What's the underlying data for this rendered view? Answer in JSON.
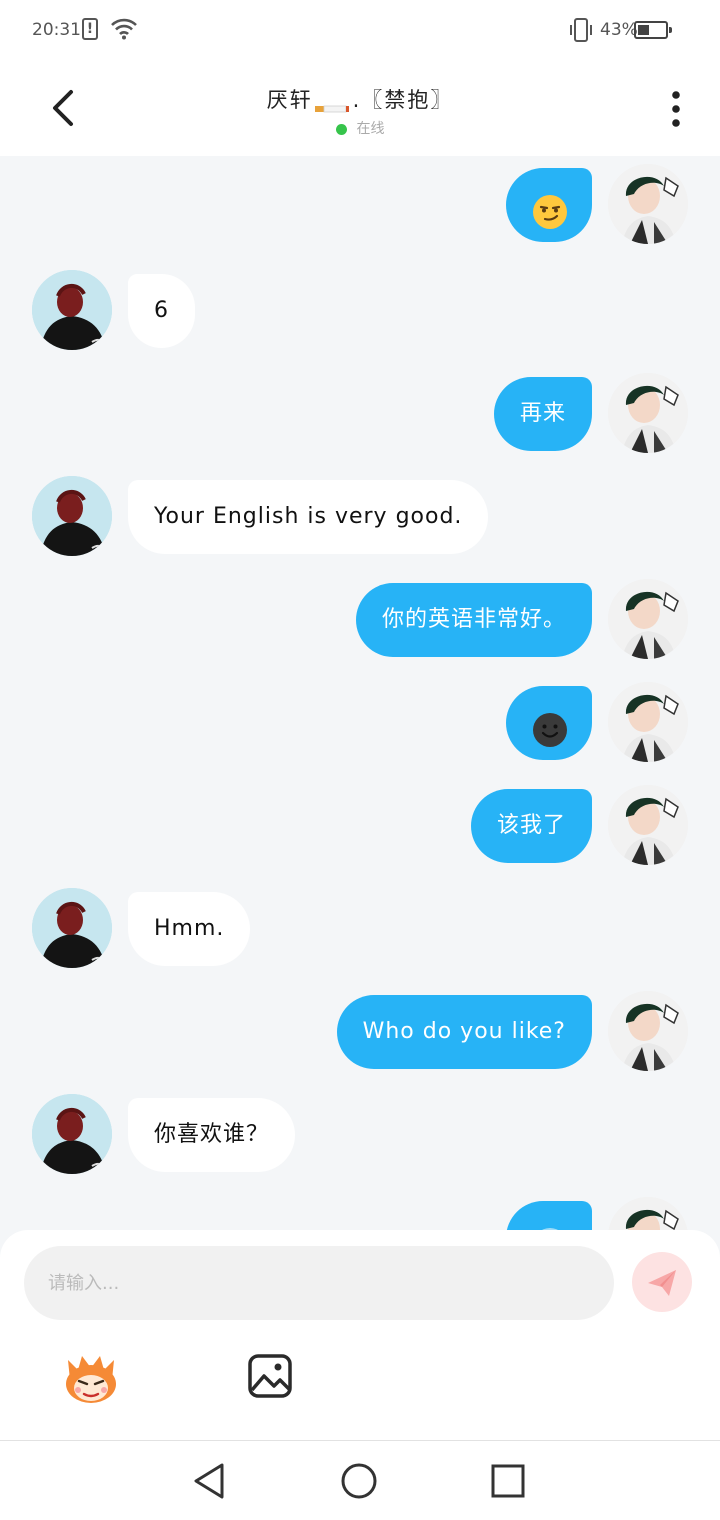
{
  "status_bar": {
    "time": "20:31",
    "sim_alert": "!",
    "battery_percent": "43%",
    "battery_level": 0.43
  },
  "header": {
    "title_pre": "厌轩",
    "title_post": ".〖禁抱〗",
    "status": "在线"
  },
  "messages": [
    {
      "side": "right",
      "emoji": "smirking-face"
    },
    {
      "side": "left",
      "text": "6"
    },
    {
      "side": "right",
      "text": "再来"
    },
    {
      "side": "left",
      "text": "Your English is very good."
    },
    {
      "side": "right",
      "text": "你的英语非常好。"
    },
    {
      "side": "right",
      "emoji": "dark-smiling-face"
    },
    {
      "side": "right",
      "text": "该我了"
    },
    {
      "side": "left",
      "text": "Hmm."
    },
    {
      "side": "right",
      "text": "Who do you like?"
    },
    {
      "side": "left",
      "text": "你喜欢谁？"
    },
    {
      "side": "right",
      "emoji": "partially-visible-emoji"
    }
  ],
  "composer": {
    "placeholder": "请输入..."
  },
  "colors": {
    "accent": "#27b3f6",
    "online": "#36c44b",
    "background": "#f4f6f8",
    "send_button": "#fde2e2"
  }
}
